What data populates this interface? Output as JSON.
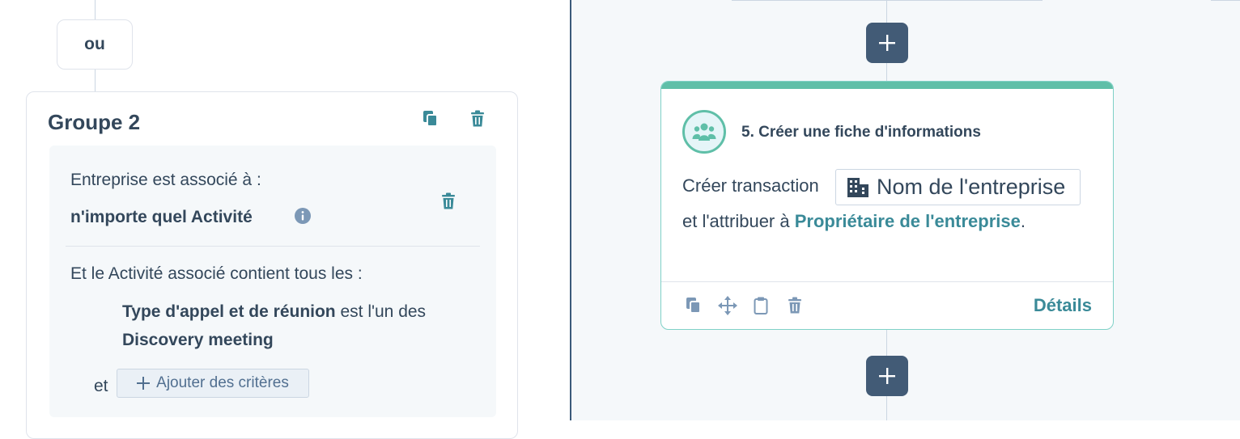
{
  "left_panel": {
    "or_label": "ou",
    "group": {
      "title": "Groupe 2",
      "condition": {
        "line1": "Entreprise est associé à :",
        "line2": "n'importe quel Activité"
      },
      "sub_condition": {
        "intro": "Et le Activité associé contient tous les :",
        "property": "Type d'appel et de réunion",
        "operator": " est l'un des",
        "value": "Discovery meeting"
      },
      "connector": "et",
      "add_criteria_label": "Ajouter des critères"
    }
  },
  "right_panel": {
    "action": {
      "title": "5. Créer une fiche d'informations",
      "create_text": "Créer transaction",
      "token_label": "Nom de l'entreprise",
      "assign_prefix": "et l'attribuer à ",
      "assign_link": "Propriétaire de l'entreprise",
      "assign_suffix": ".",
      "details_label": "Détails"
    }
  },
  "colors": {
    "accent_teal": "#5fbfa8",
    "link_teal": "#3a8a98",
    "dark_button": "#425b76",
    "text": "#33475b"
  },
  "icons": [
    "copy-icon",
    "trash-icon",
    "info-icon",
    "plus-icon",
    "contacts-icon",
    "building-icon",
    "move-icon",
    "clipboard-icon"
  ]
}
